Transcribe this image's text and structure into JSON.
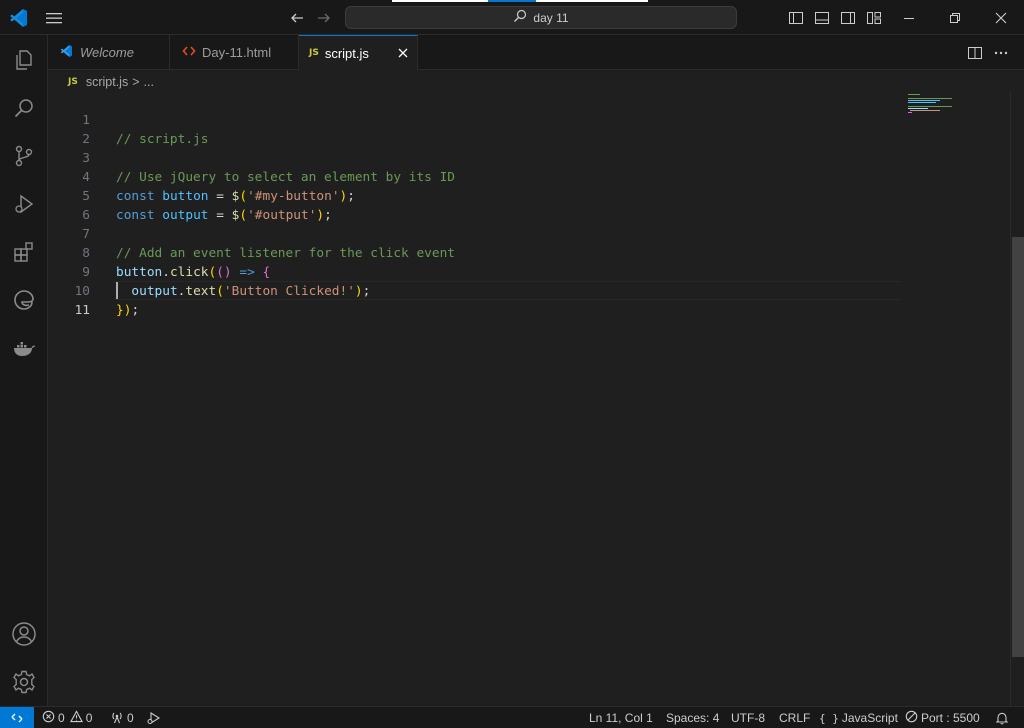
{
  "search": {
    "text": "day 11"
  },
  "tabs": [
    {
      "label": "Welcome",
      "icon": "vscode-logo-icon"
    },
    {
      "label": "Day-11.html",
      "icon": "html-file-icon"
    },
    {
      "label": "script.js",
      "icon": "js-file-icon",
      "active": true
    }
  ],
  "js_badge": "JS",
  "breadcrumb": {
    "file": "script.js",
    "separator": ">",
    "more": "..."
  },
  "editor": {
    "language": "JavaScript",
    "lines": [
      {
        "n": "1",
        "text": "// script.js"
      },
      {
        "n": "2",
        "text": ""
      },
      {
        "n": "3",
        "text": "// Use jQuery to select an element by its ID"
      },
      {
        "n": "4",
        "text": "const button = $('#my-button');"
      },
      {
        "n": "5",
        "text": "const output = $('#output');"
      },
      {
        "n": "6",
        "text": ""
      },
      {
        "n": "7",
        "text": "// Add an event listener for the click event"
      },
      {
        "n": "8",
        "text": "button.click(() => {"
      },
      {
        "n": "9",
        "text": "  output.text('Button Clicked!');"
      },
      {
        "n": "10",
        "text": "});"
      },
      {
        "n": "11",
        "text": ""
      }
    ],
    "current_line": "11"
  },
  "status": {
    "errors": "0",
    "warnings": "0",
    "ports": "0",
    "position": "Ln 11, Col 1",
    "spaces": "Spaces: 4",
    "encoding": "UTF-8",
    "eol": "CRLF",
    "language": "JavaScript",
    "port": "Port : 5500"
  },
  "colors": {
    "accent": "#0078d4",
    "background": "#1f1f1f",
    "chrome": "#181818"
  }
}
